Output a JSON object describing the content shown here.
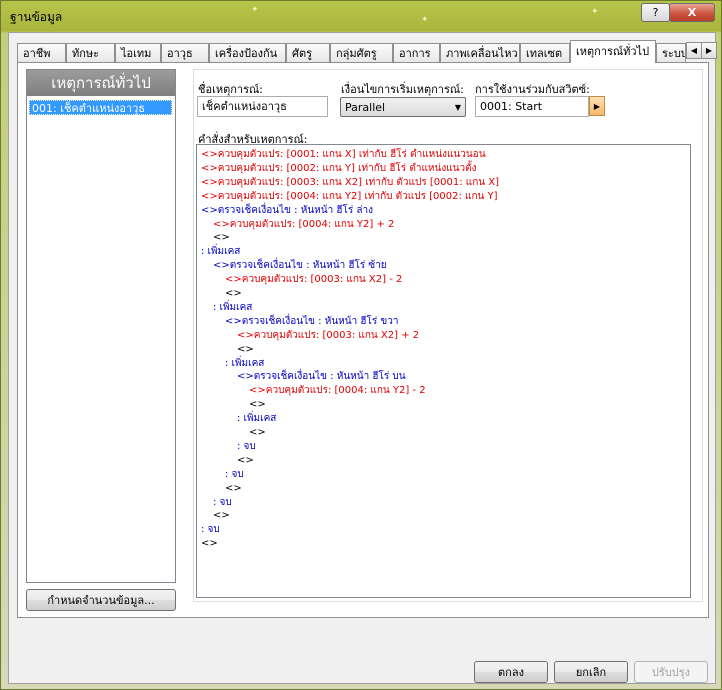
{
  "window": {
    "title": "ฐานข้อมูล",
    "help_label": "?",
    "close_label": "X"
  },
  "tabs": [
    {
      "label": "อาชีพ",
      "active": false
    },
    {
      "label": "ทักษะ",
      "active": false
    },
    {
      "label": "ไอเทม",
      "active": false
    },
    {
      "label": "อาวุธ",
      "active": false
    },
    {
      "label": "เครื่องป้องกัน",
      "active": false
    },
    {
      "label": "ศัตรู",
      "active": false
    },
    {
      "label": "กลุ่มศัตรู",
      "active": false
    },
    {
      "label": "อาการ",
      "active": false
    },
    {
      "label": "ภาพเคลื่อนไหว",
      "active": false
    },
    {
      "label": "เทลเซต",
      "active": false
    },
    {
      "label": "เหตุการณ์ทั่วไป",
      "active": true
    },
    {
      "label": "ระบบ",
      "active": false
    }
  ],
  "tab_scroll": {
    "left": "◀",
    "right": "▶"
  },
  "left_panel": {
    "header": "เหตุการณ์ทั่วไป",
    "items": [
      "001: เช็คตำแหน่งอาวุธ"
    ],
    "set_count_button": "กำหนดจำนวนข้อมูล..."
  },
  "event": {
    "name_label": "ชื่อเหตุการณ์:",
    "name_value": "เช็คตำแหน่งอาวุธ",
    "trigger_label": "เงื่อนไขการเริ่มเหตุการณ์:",
    "trigger_value": "Parallel",
    "switch_label": "การใช้งานร่วมกับสวิตซ์:",
    "switch_value": "0001: Start",
    "commands_label": "คำสั่งสำหรับเหตุการณ์:"
  },
  "commands": [
    {
      "text": "<>ควบคุมตัวแปร: [0001: แกน X] เท่ากับ ฮีโร่ ตำแหน่งแนวนอน",
      "color": "red",
      "indent": 0
    },
    {
      "text": "<>ควบคุมตัวแปร: [0002: แกน Y] เท่ากับ ฮีโร่ ตำแหน่งแนวตั้ง",
      "color": "red",
      "indent": 0
    },
    {
      "text": "<>ควบคุมตัวแปร: [0003: แกน X2] เท่ากับ ตัวแปร [0001: แกน X]",
      "color": "red",
      "indent": 0
    },
    {
      "text": "<>ควบคุมตัวแปร: [0004: แกน Y2] เท่ากับ ตัวแปร [0002: แกน Y]",
      "color": "red",
      "indent": 0
    },
    {
      "text": "<>ตรวจเช็คเงื่อนไข : หันหน้า ฮีโร่ ล่าง",
      "color": "blue",
      "indent": 0
    },
    {
      "text": "<>ควบคุมตัวแปร: [0004: แกน Y2] + 2",
      "color": "red",
      "indent": 1
    },
    {
      "text": "<>",
      "color": "black",
      "indent": 1
    },
    {
      "text": ":  เพิ่มเคส",
      "color": "blue",
      "indent": 0
    },
    {
      "text": "<>ตรวจเช็คเงื่อนไข : หันหน้า ฮีโร่ ซ้าย",
      "color": "blue",
      "indent": 1
    },
    {
      "text": "<>ควบคุมตัวแปร: [0003: แกน X2] - 2",
      "color": "red",
      "indent": 2
    },
    {
      "text": "<>",
      "color": "black",
      "indent": 2
    },
    {
      "text": ":  เพิ่มเคส",
      "color": "blue",
      "indent": 1
    },
    {
      "text": "<>ตรวจเช็คเงื่อนไข : หันหน้า ฮีโร่ ขวา",
      "color": "blue",
      "indent": 2
    },
    {
      "text": "<>ควบคุมตัวแปร: [0003: แกน X2] + 2",
      "color": "red",
      "indent": 3
    },
    {
      "text": "<>",
      "color": "black",
      "indent": 3
    },
    {
      "text": ":  เพิ่มเคส",
      "color": "blue",
      "indent": 2
    },
    {
      "text": "<>ตรวจเช็คเงื่อนไข : หันหน้า ฮีโร่ บน",
      "color": "blue",
      "indent": 3
    },
    {
      "text": "<>ควบคุมตัวแปร: [0004: แกน Y2] - 2",
      "color": "red",
      "indent": 4
    },
    {
      "text": "<>",
      "color": "black",
      "indent": 4
    },
    {
      "text": ":  เพิ่มเคส",
      "color": "blue",
      "indent": 3
    },
    {
      "text": "<>",
      "color": "black",
      "indent": 4
    },
    {
      "text": ":  จบ",
      "color": "blue",
      "indent": 3
    },
    {
      "text": "<>",
      "color": "black",
      "indent": 3
    },
    {
      "text": ":  จบ",
      "color": "blue",
      "indent": 2
    },
    {
      "text": "<>",
      "color": "black",
      "indent": 2
    },
    {
      "text": ":  จบ",
      "color": "blue",
      "indent": 1
    },
    {
      "text": "<>",
      "color": "black",
      "indent": 1
    },
    {
      "text": ":  จบ",
      "color": "blue",
      "indent": 0
    },
    {
      "text": "<>",
      "color": "black",
      "indent": 0
    }
  ],
  "buttons": {
    "ok": "ตกลง",
    "cancel": "ยกเลิก",
    "apply": "ปรับปรุง"
  },
  "colors": {
    "title_bar": "#b7c44a",
    "selection": "#3399ff",
    "command_red": "#e00000",
    "command_blue": "#0000c8"
  }
}
